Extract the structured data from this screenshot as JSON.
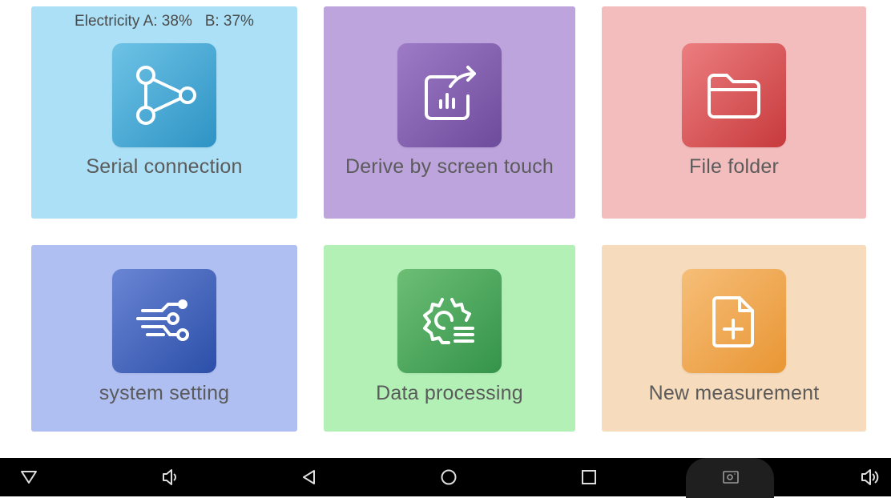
{
  "battery": {
    "label": "Electricity",
    "a_text": "A: 38%",
    "b_text": "B: 37%"
  },
  "tiles": [
    {
      "id": "serial",
      "label": "Serial connection",
      "icon": "share-nodes-icon",
      "bg": "#ABE0F6",
      "accent_from": "#6EC3E6",
      "accent_to": "#2E93C4"
    },
    {
      "id": "touch",
      "label": "Derive by screen touch",
      "icon": "chart-export-icon",
      "bg": "#BDA4DD",
      "accent_from": "#9D7BC6",
      "accent_to": "#6E4C9C"
    },
    {
      "id": "folder",
      "label": "File folder",
      "icon": "folder-icon",
      "bg": "#F3BDBE",
      "accent_from": "#EC7E80",
      "accent_to": "#C73A3C"
    },
    {
      "id": "settings",
      "label": "system setting",
      "icon": "circuit-settings-icon",
      "bg": "#AFBFF2",
      "accent_from": "#6A85D4",
      "accent_to": "#2B4FA8"
    },
    {
      "id": "data",
      "label": "Data processing",
      "icon": "gear-list-icon",
      "bg": "#B2F0B6",
      "accent_from": "#6DBE75",
      "accent_to": "#34934A"
    },
    {
      "id": "new",
      "label": "New measurement",
      "icon": "file-plus-icon",
      "bg": "#F6DBBC",
      "accent_from": "#F6BE78",
      "accent_to": "#E99634"
    }
  ],
  "navbar": {
    "colors": {
      "bg": "#000000",
      "icon": "#dedede",
      "pill": "#1f1f1f"
    },
    "buttons": [
      "hide-nav-icon",
      "volume-down-icon",
      "back-icon",
      "home-icon",
      "recents-icon",
      "screenshot-icon",
      "volume-up-icon"
    ]
  }
}
